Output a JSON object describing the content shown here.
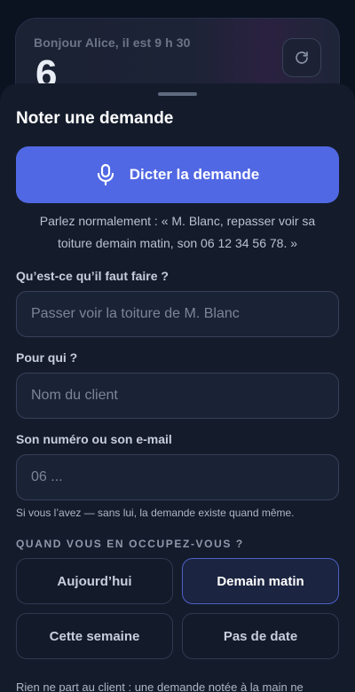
{
  "background": {
    "greeting": "Bonjour Alice, il est 9 h 30",
    "big_number": "6",
    "refresh_icon": "refresh-icon"
  },
  "sheet": {
    "title": "Noter une demande",
    "dictate_button": {
      "label": "Dicter la demande",
      "icon": "microphone-icon"
    },
    "hint": "Parlez normalement : « M. Blanc, repasser voir sa toiture demain matin, son 06 12 34 56 78. »",
    "fields": {
      "task": {
        "label": "Qu’est-ce qu’il faut faire ?",
        "placeholder": "Passer voir la toiture de M. Blanc",
        "value": ""
      },
      "client": {
        "label": "Pour qui ?",
        "placeholder": "Nom du client",
        "value": ""
      },
      "contact": {
        "label": "Son numéro ou son e-mail",
        "placeholder": "06 ...",
        "value": ""
      }
    },
    "contact_note": "Si vous l’avez — sans lui, la demande existe quand même.",
    "when": {
      "section_title": "QUAND VOUS EN OCCUPEZ-VOUS ?",
      "options": [
        "Aujourd’hui",
        "Demain matin",
        "Cette semaine",
        "Pas de date"
      ],
      "selected": "Demain matin"
    },
    "footer": "Rien ne part au client : une demande notée à la main ne"
  },
  "colors": {
    "accent": "#5168e4",
    "sheet_bg": "#141c2c",
    "selected_chip_border": "#4d5fc6"
  }
}
